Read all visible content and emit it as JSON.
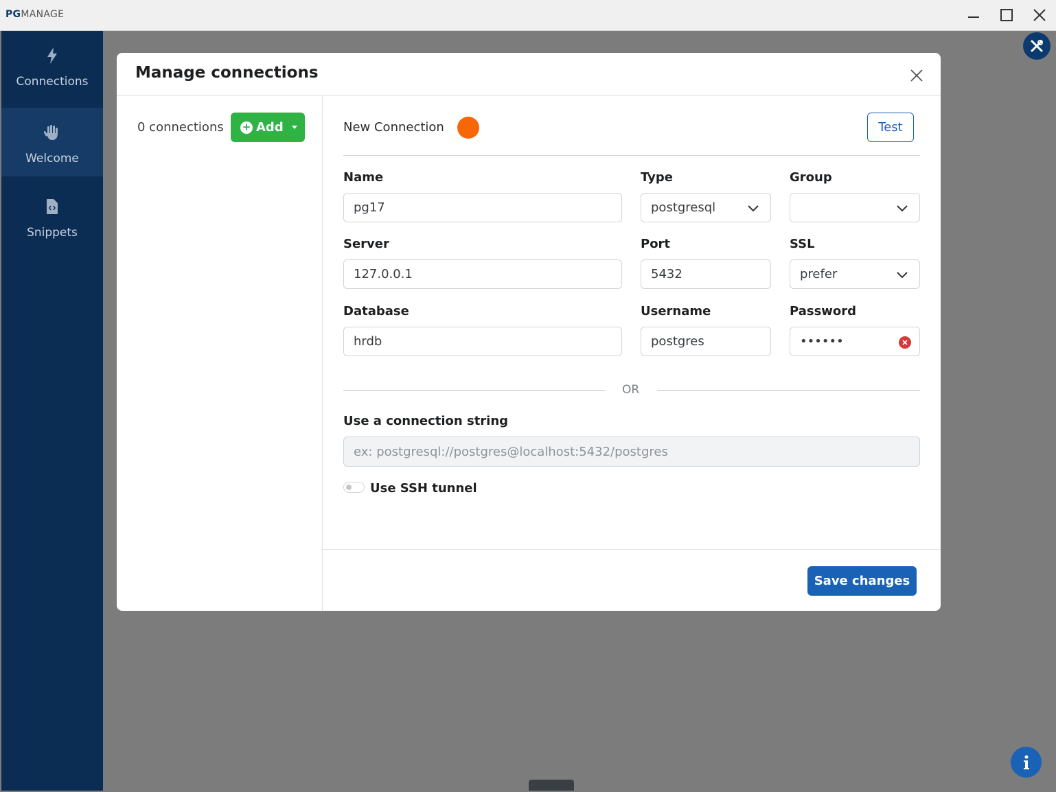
{
  "window": {
    "title_pg": "PG",
    "title_manage": "MANAGE"
  },
  "sidebar": {
    "items": [
      {
        "label": "Connections",
        "icon": "bolt-icon",
        "active": false
      },
      {
        "label": "Welcome",
        "icon": "hand-icon",
        "active": true
      },
      {
        "label": "Snippets",
        "icon": "code-file-icon",
        "active": false
      }
    ]
  },
  "modal": {
    "title": "Manage connections",
    "connections_count": "0 connections",
    "add_label": "Add",
    "connection_title": "New Connection",
    "connection_color": "#f76707",
    "test_label": "Test",
    "fields": {
      "name": {
        "label": "Name",
        "value": "pg17"
      },
      "type": {
        "label": "Type",
        "value": "postgresql"
      },
      "group": {
        "label": "Group",
        "value": ""
      },
      "server": {
        "label": "Server",
        "value": "127.0.0.1"
      },
      "port": {
        "label": "Port",
        "value": "5432"
      },
      "ssl": {
        "label": "SSL",
        "value": "prefer"
      },
      "database": {
        "label": "Database",
        "value": "hrdb"
      },
      "username": {
        "label": "Username",
        "value": "postgres"
      },
      "password": {
        "label": "Password",
        "value": "••••••"
      }
    },
    "or_text": "OR",
    "connection_string": {
      "label": "Use a connection string",
      "placeholder": "ex: postgresql://postgres@localhost:5432/postgres",
      "value": ""
    },
    "ssh": {
      "label": "Use SSH tunnel",
      "enabled": false
    },
    "save_label": "Save changes"
  },
  "colors": {
    "sidebar": "#0b2d54",
    "primary": "#1a62b6",
    "success": "#2fb344",
    "danger": "#d63939"
  }
}
